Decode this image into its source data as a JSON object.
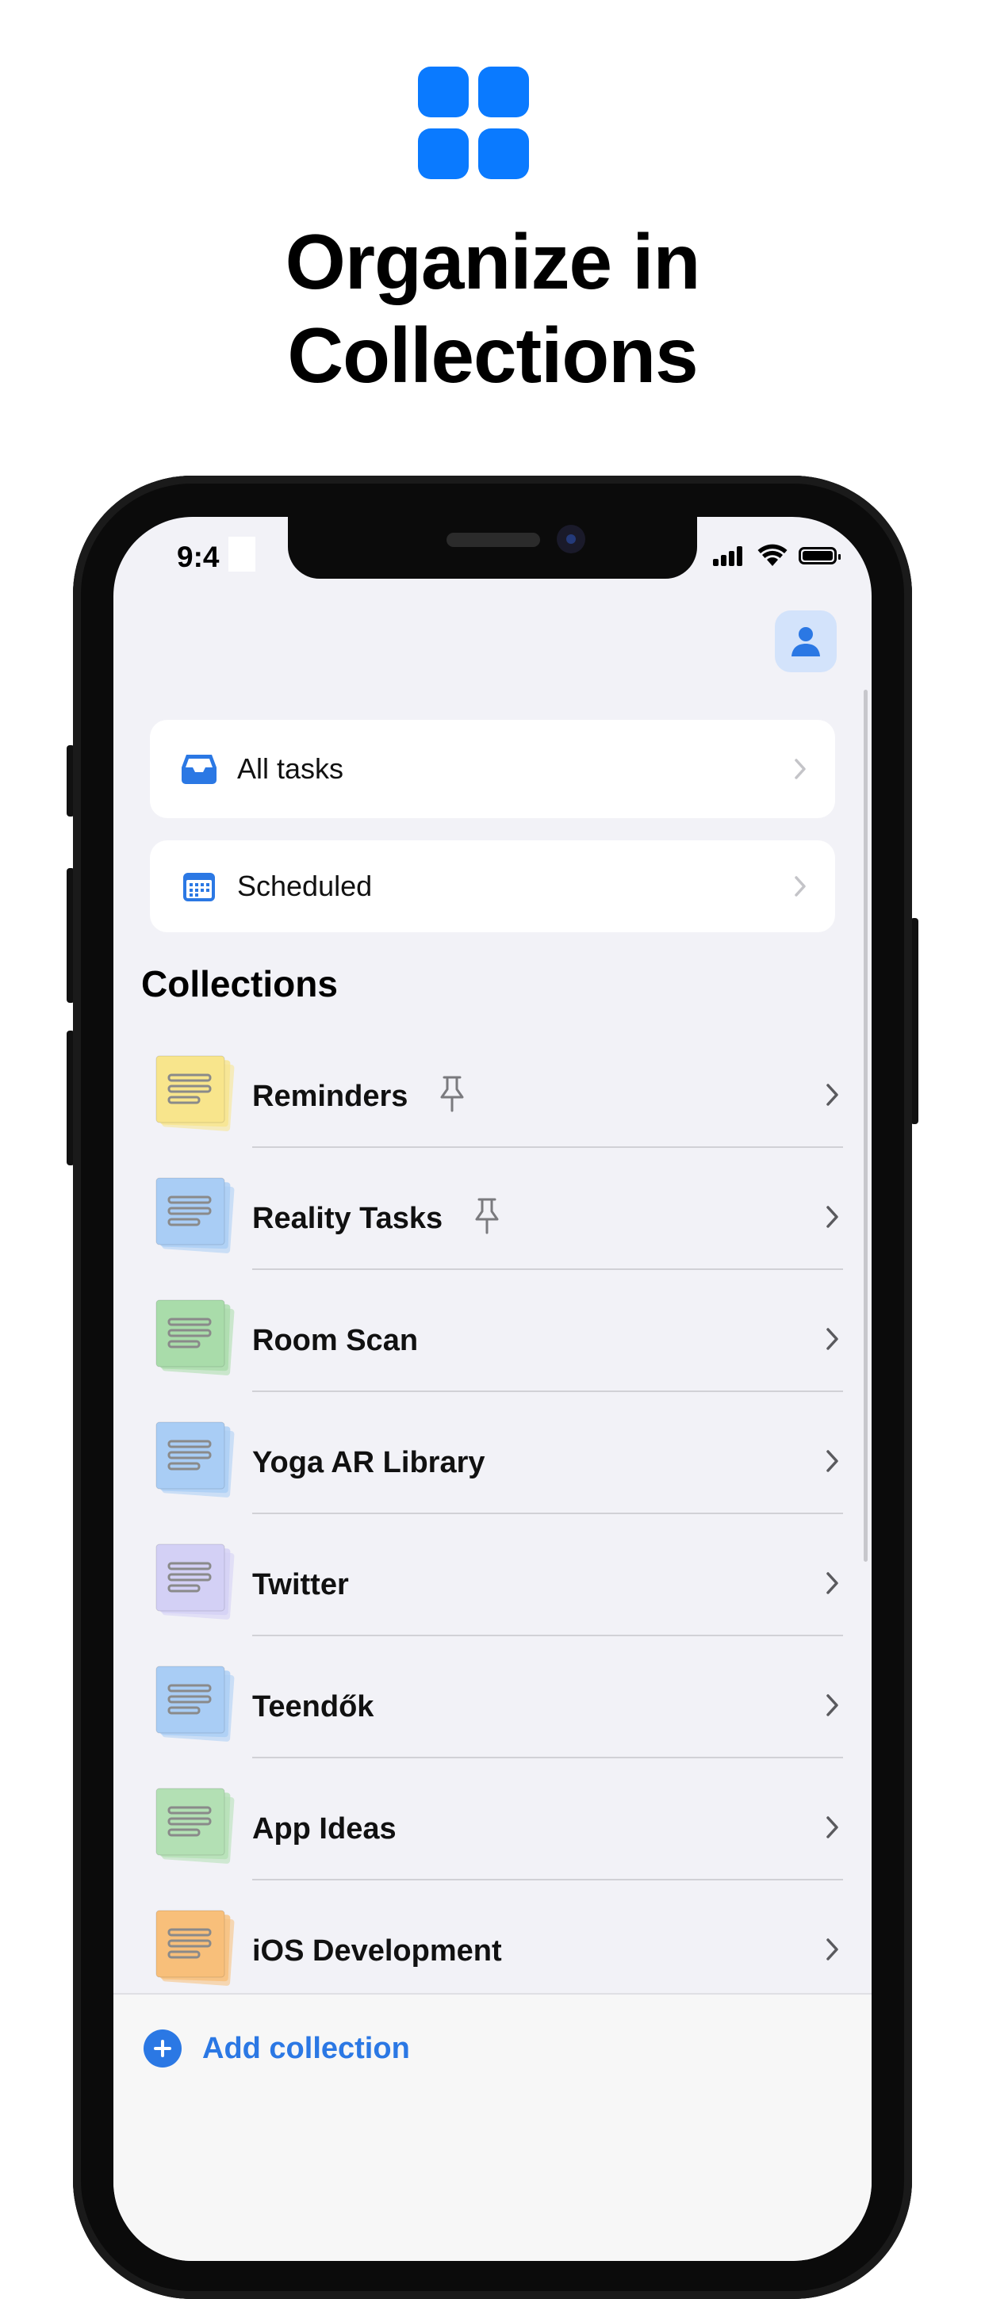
{
  "promo": {
    "title_line1": "Organize in",
    "title_line2": "Collections",
    "icon": "grid-icon",
    "accent": "#0a7aff"
  },
  "status_bar": {
    "time": "9:4",
    "icons": [
      "cellular-signal-icon",
      "wifi-icon",
      "battery-icon"
    ]
  },
  "header": {
    "profile_icon": "person-icon"
  },
  "smart_lists": [
    {
      "label": "All tasks",
      "icon": "inbox-tray-icon"
    },
    {
      "label": "Scheduled",
      "icon": "calendar-icon"
    }
  ],
  "collections_section": {
    "title": "Collections"
  },
  "collections": [
    {
      "name": "Reminders",
      "color": "#f8e58c",
      "pinned": true
    },
    {
      "name": "Reality Tasks",
      "color": "#a9cdf5",
      "pinned": true
    },
    {
      "name": "Room Scan",
      "color": "#a9dcaa",
      "pinned": false
    },
    {
      "name": "Yoga AR Library",
      "color": "#a9cdf5",
      "pinned": false
    },
    {
      "name": "Twitter",
      "color": "#d3d0f5",
      "pinned": false
    },
    {
      "name": "Teendők",
      "color": "#a9cdf5",
      "pinned": false
    },
    {
      "name": "App Ideas",
      "color": "#b3e0b4",
      "pinned": false
    },
    {
      "name": "iOS Development",
      "color": "#f8bf7a",
      "pinned": false
    }
  ],
  "bottom_bar": {
    "add_label": "Add collection",
    "add_icon": "plus-circle-icon",
    "accent": "#2b78e4"
  }
}
